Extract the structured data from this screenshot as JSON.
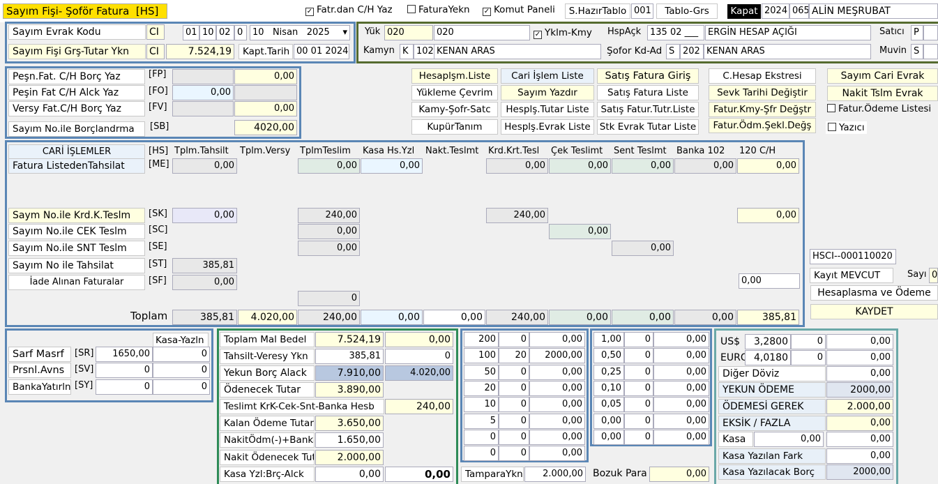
{
  "header": {
    "title": "Sayım Fişi- Şoför Fatura",
    "hs": "[HS]",
    "cb_fatr": "Fatr.dan C/H Yaz",
    "cb_fatura_yekn": "FaturaYekn",
    "cb_komut": "Komut Paneli",
    "s_hazir_tablo": "S.HazırTablo",
    "tablo_no": "001",
    "tablo_grs": "Tablo-Grs",
    "kapat": "Kapat",
    "year": "2024",
    "code": "065",
    "company": "ALİN MEŞRUBAT"
  },
  "evrak": {
    "kodu_label": "Sayım Evrak Kodu",
    "kodu_val": "CI",
    "d1": "01",
    "d2": "10",
    "d3": "02",
    "d4": "0",
    "day": "10",
    "month": "Nisan",
    "yr": "2025",
    "grs_label": "Sayım Fişi Grş-Tutar Ykn",
    "grs_val": "CI",
    "amount": "7.524,19",
    "kapt_label": "Kapt.Tarih",
    "kapt_val": "00 01 2024"
  },
  "yuk": {
    "yuk_label": "Yük",
    "yuk1": "020",
    "yuk2": "020",
    "yklm_kmy": "Yklm-Kmy",
    "hspack_label": "HspAçk",
    "hspack_code": "135 02 ___",
    "hspack_name": "ERGİN HESAP AÇIĞI",
    "satici_label": "Satıcı",
    "satici_val": "P",
    "kamyn_label": "Kamyn",
    "kamyn_k": "K",
    "kamyn_code": "102",
    "kamyn_name": "KENAN ARAS",
    "sofor_label": "Şofor Kd-Ad",
    "sofor_s": "S",
    "sofor_code": "202",
    "sofor_name": "KENAN ARAS",
    "muvin_label": "Muvin",
    "muvin_val": "S"
  },
  "pesin": {
    "r1_label": "Peşn.Fat. C/H Borç Yaz",
    "r1_code": "[FP]",
    "r1_val": "0,00",
    "r2_label": "Peşin Fat C/H Alck Yaz",
    "r2_code": "[FO]",
    "r2_val": "0,00",
    "r3_label": "Versy Fat.C/H Borç Yaz",
    "r3_code": "[FV]",
    "r3_val": "0,00",
    "r4_label": "Sayım No.ile Borçlandrma",
    "r4_code": "[SB]",
    "r4_val": "4020,00"
  },
  "buttons": {
    "hesaplsm_liste": "Hesaplşm.Liste",
    "cari_islem": "Cari İşlem Liste",
    "satis_fatura_giris": "Satış Fatura Giriş",
    "yukleme_cevrim": "Yükleme Çevrim",
    "sayim_yazdir": "Sayım Yazdır",
    "satis_fatura_liste": "Satış Fatura Liste",
    "kamy_sofr": "Kamy-Şofr-Satc",
    "hespls_tutar": "Hesplş.Tutar Liste",
    "satis_fatur_tutr": "Satış Fatur.Tutr.Liste",
    "kupur_tanim": "KupürTanım",
    "hespls_evrak": "Hesplş.Evrak Liste",
    "stk_evrak": "Stk Evrak Tutar Liste",
    "c_hesap": "C.Hesap Ekstresi",
    "sevk_tarihi": "Sevk Tarihi Değiştir",
    "fatur_kmy": "Fatur.Kmy-Şfr Değştr",
    "fatur_odm": "Fatur.Ödm.Şekl.Değş",
    "sayim_cari": "Sayım Cari Evrak",
    "nakit_tslm": "Nakit Tslm Evrak",
    "fatur_odeme": "Fatur.Ödeme Listesi",
    "yazici": "Yazıcı"
  },
  "cari": {
    "headers": [
      "CARİ İŞLEMLER",
      "[HS]",
      "Tplm.Tahsilt",
      "Tplm.Versy",
      "TplmTeslim",
      "Kasa Hs.Yzl",
      "Nakt.Teslmt",
      "Krd.Krt.Tesl",
      "Çek Teslimt",
      "Sent Teslmt",
      "Banka 102",
      "120 C/H"
    ],
    "fatura_label": "Fatura ListedenTahsilat",
    "fatura_code": "[ME]",
    "fatura_vals": [
      "0,00",
      "0,00",
      "0,00",
      "0,00",
      "0,00",
      "0,00",
      "0,00",
      "0,00"
    ],
    "sk_label": "Saym No.ile Krd.K.Teslm",
    "sk_code": "[SK]",
    "sk_v1": "0,00",
    "sk_v2": "240,00",
    "sk_v3": "240,00",
    "sk_v4": "0,00",
    "sc_label": "Sayım No.ile CEK Teslm",
    "sc_code": "[SC]",
    "sc_v1": "0,00",
    "sc_v2": "0,00",
    "se_label": "Sayım No.ile SNT Teslm",
    "se_code": "[SE]",
    "se_v1": "0,00",
    "se_v2": "0,00",
    "st_label": "Sayım No ile Tahsilat",
    "st_code": "[ST]",
    "st_v1": "385,81",
    "sf_label": "İade Alınan Faturalar",
    "sf_code": "[SF]",
    "sf_v1": "0,00",
    "sf_v2": "0,00",
    "zero_val": "0",
    "toplam_label": "Toplam",
    "toplam_vals": [
      "385,81",
      "4.020,00",
      "240,00",
      "0,00",
      "0,00",
      "240,00",
      "0,00",
      "0,00",
      "0,00",
      "385,81"
    ]
  },
  "hscl": {
    "code": "HSCI--000110020",
    "kayit": "Kayıt MEVCUT",
    "sayi_label": "Sayı",
    "sayi_val": "0",
    "hesaplasma": "Hesaplasma ve Ödeme",
    "kaydet": "KAYDET"
  },
  "sarf": {
    "header": "Kasa-Yazln",
    "sr_label": "Sarf Masrf",
    "sr_code": "[SR]",
    "sr_v1": "1650,00",
    "sr_v2": "0",
    "sv_label": "Prsnl.Avns",
    "sv_code": "[SV]",
    "sv_v1": "0",
    "sv_v2": "0",
    "sy_label": "BankaYatırln",
    "sy_code": "[SY]",
    "sy_v1": "0",
    "sy_v2": "0"
  },
  "summary": {
    "toplam_mal": "Toplam Mal Bedel",
    "toplam_mal_v1": "7.524,19",
    "toplam_mal_v2": "0,00",
    "tahsilt": "Tahsilt-Veresy Ykn",
    "tahsilt_v1": "385,81",
    "tahsilt_v2": "0",
    "yekun": "Yekun Borç Alack",
    "yekun_v1": "7.910,00",
    "yekun_v2": "4.020,00",
    "odenecek": "Ödenecek Tutar",
    "odenecek_v": "3.890,00",
    "teslimt": "Teslimt KrK-Cek-Snt-Banka Hesb",
    "teslimt_v": "240,00",
    "kalan": "Kalan Ödeme Tutarı",
    "kalan_v": "3.650,00",
    "nakit_odm": "NakitÖdm(-)+Banka",
    "nakit_odm_v": "1.650,00",
    "nakit_od": "Nakit Ödenecek Tut",
    "nakit_od_v": "2.000,00",
    "kasa_yzl": "Kasa Yzl:Brç-Alck",
    "kasa_yzl_v1": "0,00",
    "kasa_yzl_v2": "0,00"
  },
  "kupur1": [
    [
      "200",
      "0",
      "0,00"
    ],
    [
      "100",
      "20",
      "2000,00"
    ],
    [
      "50",
      "0",
      "0,00"
    ],
    [
      "20",
      "0",
      "0,00"
    ],
    [
      "10",
      "0",
      "0,00"
    ],
    [
      "5",
      "0",
      "0,00"
    ],
    [
      "0",
      "0",
      "0,00"
    ],
    [
      "0",
      "0",
      "0,00"
    ]
  ],
  "kupur2": [
    [
      "1,00",
      "0",
      "0,00"
    ],
    [
      "0,50",
      "0",
      "0,00"
    ],
    [
      "0,25",
      "0",
      "0,00"
    ],
    [
      "0,10",
      "0",
      "0,00"
    ],
    [
      "0,05",
      "0",
      "0,00"
    ],
    [
      "0,00",
      "0",
      "0,00"
    ],
    [
      "0,00",
      "0",
      "0,00"
    ]
  ],
  "tampara": {
    "label": "TamparaYkn",
    "val": "2.000,00",
    "bozuk": "Bozuk Para",
    "bozuk_val": "0,00"
  },
  "doviz": {
    "usd": "US$",
    "usd_rate": "3,2800",
    "usd_q": "0",
    "usd_v": "0,00",
    "eur": "EURO",
    "eur_rate": "4,0180",
    "eur_q": "0",
    "eur_v": "0,00",
    "diger": "Diğer Döviz",
    "diger_v": "0,00",
    "yekun": "YEKUN ÖDEME",
    "yekun_v": "2000,00",
    "gerek": "ÖDEMESİ GEREK",
    "gerek_v": "2.000,00",
    "eksik": "EKSİK / FAZLA",
    "eksik_v": "0,00",
    "kasa": "Kasa",
    "kasa_v1": "0,00",
    "kasa_v2": "0,00",
    "kasa_yazilan": "Kasa Yazılan Fark",
    "kasa_yazilan_v": "0,00",
    "kasa_yazilacak": "Kasa Yazılacak Borç",
    "kasa_yazilacak_v": "2000,00"
  }
}
